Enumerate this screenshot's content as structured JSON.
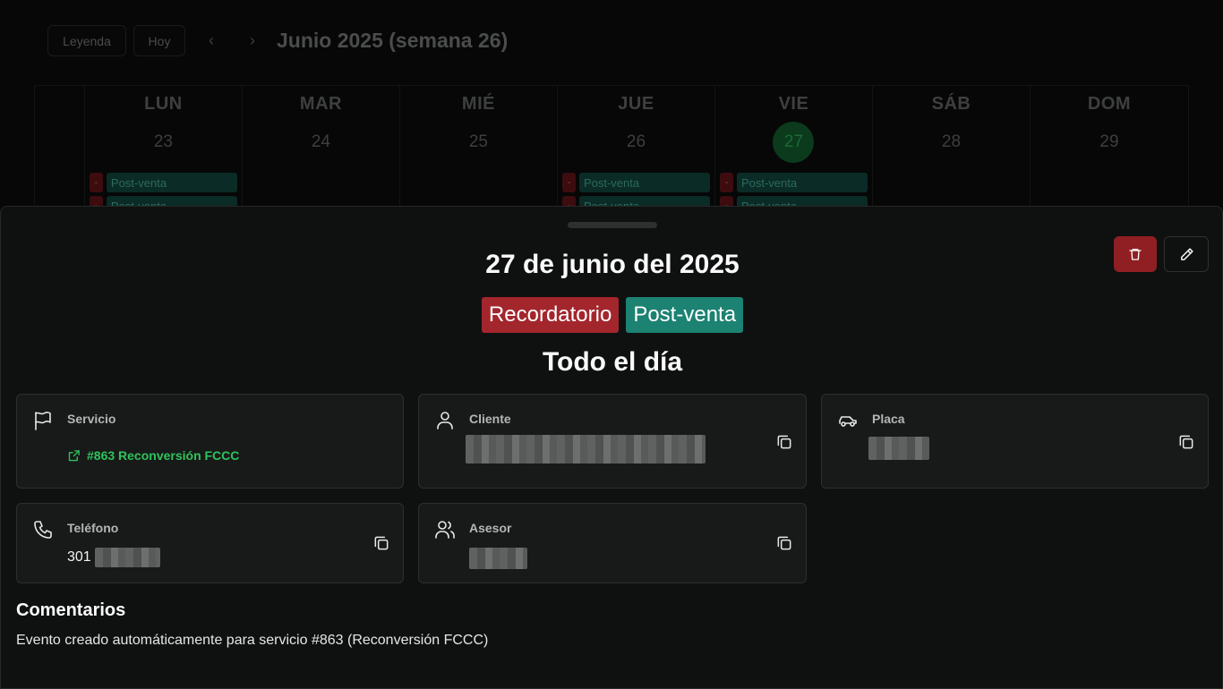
{
  "calendar": {
    "legend_label": "Leyenda",
    "today_label": "Hoy",
    "prev_icon": "chevron-left-icon",
    "next_icon": "chevron-right-icon",
    "prev_glyph": "‹",
    "next_glyph": "›",
    "week_title": "Junio 2025 (semana 26)",
    "days": [
      {
        "name": "LUN",
        "number": "23",
        "events": [
          {
            "reminder": "-",
            "label": "Post-venta"
          },
          {
            "reminder": "-",
            "label": "Post-venta"
          }
        ]
      },
      {
        "name": "MAR",
        "number": "24",
        "events": []
      },
      {
        "name": "MIÉ",
        "number": "25",
        "events": []
      },
      {
        "name": "JUE",
        "number": "26",
        "events": [
          {
            "reminder": "-",
            "label": "Post-venta"
          },
          {
            "reminder": "-",
            "label": "Post-venta"
          }
        ]
      },
      {
        "name": "VIE",
        "number": "27",
        "today": true,
        "events": [
          {
            "reminder": "-",
            "label": "Post-venta"
          },
          {
            "reminder": "-",
            "label": "Post-venta"
          }
        ]
      },
      {
        "name": "SÁB",
        "number": "28",
        "events": []
      },
      {
        "name": "DOM",
        "number": "29",
        "events": []
      }
    ]
  },
  "sheet": {
    "date_title": "27 de junio del 2025",
    "badges": {
      "reminder": "Recordatorio",
      "type": "Post-venta"
    },
    "time_label": "Todo el día",
    "delete_icon": "trash-icon",
    "edit_icon": "pencil-icon",
    "cards": {
      "service": {
        "label": "Servicio",
        "icon": "flag-icon",
        "link_text": "#863 Reconversión FCCC",
        "link_icon": "external-link-icon"
      },
      "client": {
        "label": "Cliente",
        "icon": "user-icon",
        "value_redacted": true
      },
      "plate": {
        "label": "Placa",
        "icon": "car-icon",
        "value_redacted": true
      },
      "phone": {
        "label": "Teléfono",
        "icon": "phone-icon",
        "prefix": "301",
        "value_redacted": true
      },
      "advisor": {
        "label": "Asesor",
        "icon": "users-icon",
        "value_redacted": true
      }
    },
    "comments_title": "Comentarios",
    "comments_text": "Evento creado automáticamente para servicio #863 (Reconversión FCCC)"
  },
  "colors": {
    "reminder": "#a3262d",
    "post_venta": "#1c8272",
    "link_green": "#2fc35b",
    "delete_red": "#8f1f23",
    "today_green": "#0c3a1c"
  }
}
